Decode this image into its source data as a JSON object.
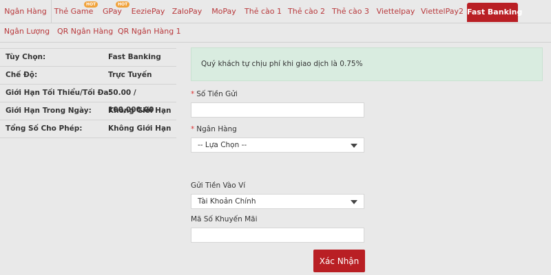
{
  "tabs_row1": [
    {
      "label": "Ngân Hàng",
      "hot": false,
      "active": false
    },
    {
      "label": "Thẻ Game",
      "hot": true,
      "active": false
    },
    {
      "label": "GPay",
      "hot": true,
      "active": false
    },
    {
      "label": "EeziePay",
      "hot": false,
      "active": false
    },
    {
      "label": "ZaloPay",
      "hot": false,
      "active": false
    },
    {
      "label": "MoPay",
      "hot": false,
      "active": false
    },
    {
      "label": "Thẻ cào 1",
      "hot": false,
      "active": false
    },
    {
      "label": "Thẻ cào 2",
      "hot": false,
      "active": false
    },
    {
      "label": "Thẻ cào 3",
      "hot": false,
      "active": false
    },
    {
      "label": "Viettelpay",
      "hot": false,
      "active": false
    },
    {
      "label": "ViettelPay2",
      "hot": false,
      "active": false
    },
    {
      "label": "Fast Banking",
      "hot": false,
      "active": true
    }
  ],
  "tabs_row2": [
    {
      "label": "Ngân Lượng"
    },
    {
      "label": "QR Ngân Hàng"
    },
    {
      "label": "QR Ngân Hàng 1"
    }
  ],
  "hot_badge": "HOT",
  "info": [
    {
      "label": "Tùy Chọn:",
      "value": "Fast Banking"
    },
    {
      "label": "Chế Độ:",
      "value": "Trực Tuyến"
    },
    {
      "label": "Giới Hạn Tối Thiểu/Tối Đa:",
      "value": "50.00 / 100,000.00"
    },
    {
      "label": "Giới Hạn Trong Ngày:",
      "value": "Không Giới Hạn"
    },
    {
      "label": "Tổng Số Cho Phép:",
      "value": "Không Giới Hạn"
    }
  ],
  "notice": "Quý khách tự chịu phí khi giao dịch là 0.75%",
  "form": {
    "required_mark": "*",
    "amount_label": "Số Tiền Gửi",
    "amount_value": "",
    "bank_label": "Ngân Hàng",
    "bank_selected": "-- Lựa Chọn --",
    "wallet_label": "Gửi Tiền Vào Ví",
    "wallet_selected": "Tài Khoản Chính",
    "promo_label": "Mã Số Khuyến Mãi",
    "promo_value": "",
    "submit_label": "Xác Nhận"
  },
  "colors": {
    "accent": "#b91f24",
    "tab_text": "#b8383b",
    "notice_bg": "#d9ece0",
    "hot_badge": "#f0a23a"
  }
}
